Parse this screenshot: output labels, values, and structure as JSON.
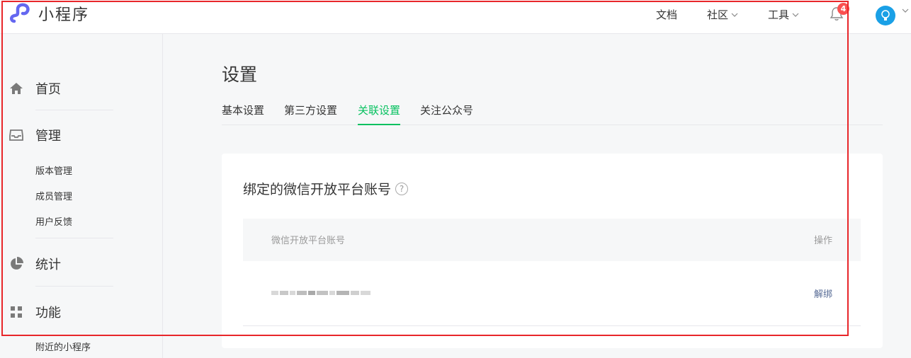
{
  "header": {
    "app_name": "小程序",
    "nav": [
      {
        "label": "文档"
      },
      {
        "label": "社区"
      },
      {
        "label": "工具"
      }
    ],
    "notification_count": "4",
    "brand_color": "#6467f0"
  },
  "sidebar": {
    "home": "首页",
    "manage": "管理",
    "manage_items": [
      "版本管理",
      "成员管理",
      "用户反馈"
    ],
    "stats": "统计",
    "features": "功能",
    "feature_items": [
      "附近的小程序"
    ]
  },
  "main": {
    "title": "设置",
    "tabs": [
      {
        "label": "基本设置"
      },
      {
        "label": "第三方设置"
      },
      {
        "label": "关联设置",
        "active": true
      },
      {
        "label": "关注公众号"
      }
    ],
    "accent_color": "#07c160",
    "card": {
      "title": "绑定的微信开放平台账号",
      "help_symbol": "?",
      "col_account": "微信开放平台账号",
      "col_action": "操作",
      "action_label": "解绑"
    }
  },
  "colors": {
    "highlight_box": "#e8262a",
    "link": "#576b95",
    "badge": "#fa5151"
  }
}
